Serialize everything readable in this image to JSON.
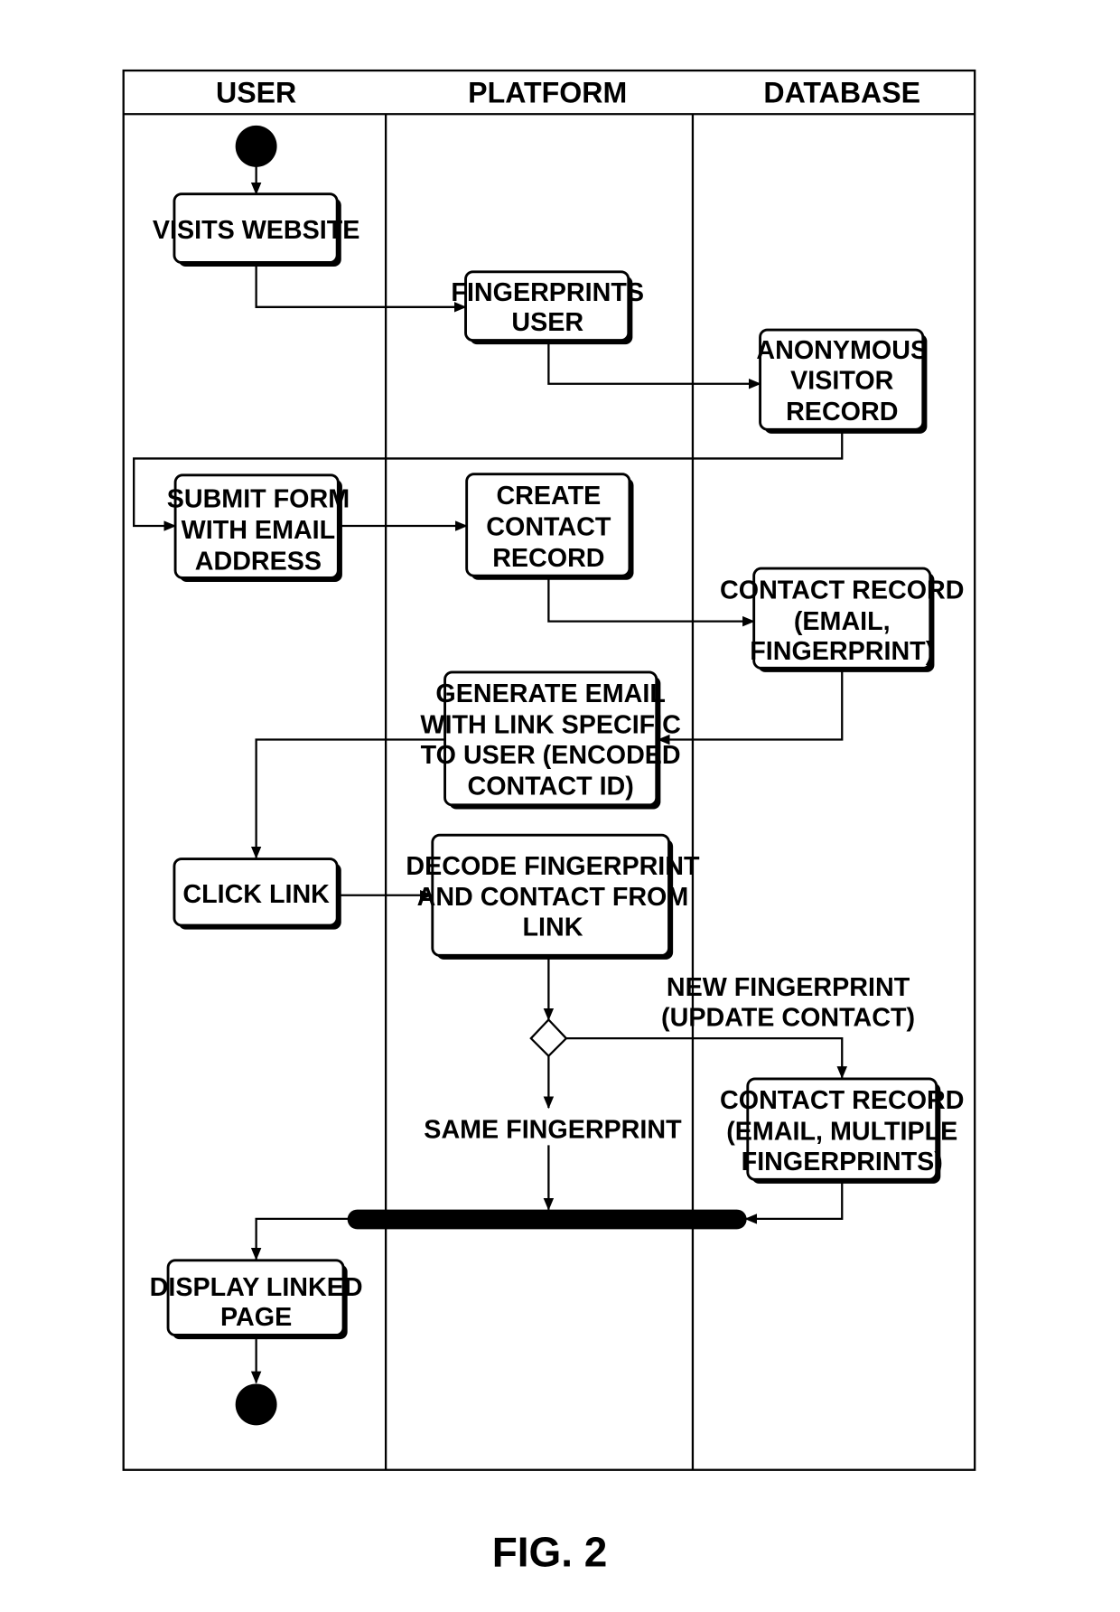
{
  "figure_label": "FIG. 2",
  "lanes": [
    {
      "id": "user",
      "label": "USER"
    },
    {
      "id": "platform",
      "label": "PLATFORM"
    },
    {
      "id": "database",
      "label": "DATABASE"
    }
  ],
  "nodes": {
    "visits_website": [
      "VISITS WEBSITE"
    ],
    "fingerprints_user": [
      "FINGERPRINTS",
      "USER"
    ],
    "anonymous_visitor_record": [
      "ANONYMOUS",
      "VISITOR",
      "RECORD"
    ],
    "submit_form": [
      "SUBMIT FORM",
      "WITH EMAIL",
      "ADDRESS"
    ],
    "create_contact_record": [
      "CREATE",
      "CONTACT",
      "RECORD"
    ],
    "contact_record": [
      "CONTACT RECORD",
      "(EMAIL,",
      "FINGERPRINT)"
    ],
    "generate_email": [
      "GENERATE EMAIL",
      "WITH LINK SPECIFIC",
      "TO USER (ENCODED",
      "CONTACT ID)"
    ],
    "click_link": [
      "CLICK LINK"
    ],
    "decode_fingerprint": [
      "DECODE FINGERPRINT",
      "AND CONTACT FROM",
      "LINK"
    ],
    "contact_record_multi": [
      "CONTACT RECORD",
      "(EMAIL, MULTIPLE",
      "FINGERPRINTS)"
    ],
    "display_linked_page": [
      "DISPLAY LINKED",
      "PAGE"
    ]
  },
  "guards": {
    "new_fingerprint": [
      "NEW FINGERPRINT",
      "(UPDATE CONTACT)"
    ],
    "same_fingerprint": [
      "SAME FINGERPRINT"
    ]
  }
}
